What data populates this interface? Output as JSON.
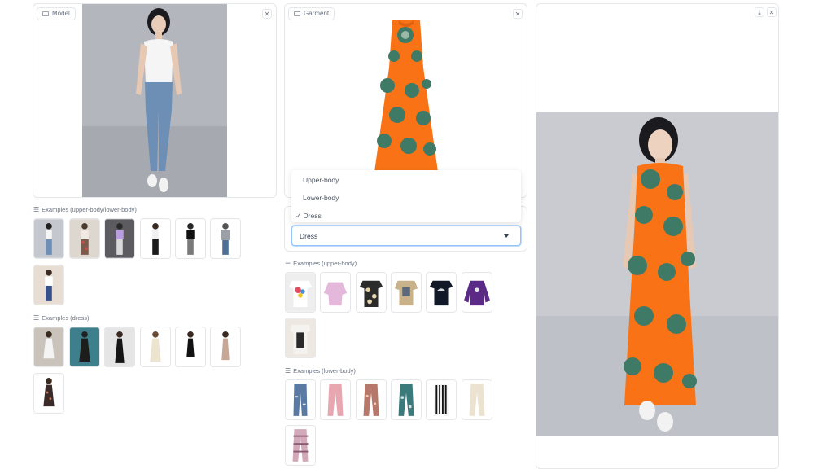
{
  "model_panel": {
    "label": "Model",
    "close_icon": "✕"
  },
  "garment_panel": {
    "label": "Garment",
    "close_icon": "✕"
  },
  "result_panel": {
    "download_icon": "⤓",
    "close_icon": "✕"
  },
  "garment_type": {
    "options": [
      "Upper-body",
      "Lower-body",
      "Dress"
    ],
    "selected": "Dress",
    "check_mark": "✓"
  },
  "examples_model_upper_lower": {
    "label": "Examples (upper-body/lower-body)",
    "items": [
      "model-white-tank-jeans",
      "model-patterned-pants",
      "model-purple-top",
      "model-black-pants",
      "model-black-tee",
      "model-grey-sweater",
      "model-white-tee-jeans"
    ]
  },
  "examples_model_dress": {
    "label": "Examples (dress)",
    "items": [
      "model-white-dress",
      "model-black-dress-blue-bg",
      "model-black-maxi-dress",
      "model-cream-dress",
      "model-black-slip-dress",
      "model-beige-dress",
      "model-dark-print-dress"
    ]
  },
  "examples_garment_upper": {
    "label": "Examples (upper-body)",
    "items": [
      "white-print-tee",
      "pink-ruffle-blouse",
      "floral-black-tee",
      "patterned-shirt",
      "black-wave-tee",
      "purple-sweatshirt",
      "armani-tee"
    ]
  },
  "examples_garment_lower": {
    "label": "Examples (lower-body)",
    "items": [
      "ripped-jeans",
      "pink-pants",
      "patterned-trousers",
      "camo-pants",
      "striped-pants",
      "cream-trousers",
      "striped-pink-pants"
    ]
  },
  "colors": {
    "accent": "#3b82f6",
    "dress_orange": "#f97316",
    "print_green": "#3f7a66",
    "denim": "#6d8fb5",
    "backdrop_grey": "#c9cbd1"
  }
}
